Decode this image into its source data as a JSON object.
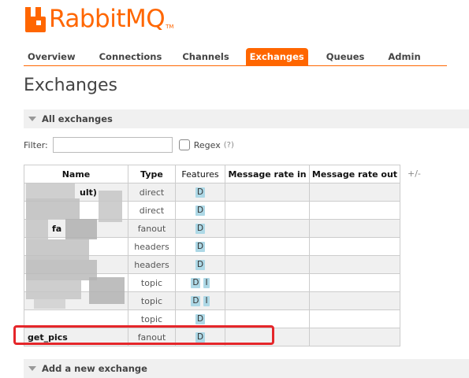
{
  "brand": {
    "name": "RabbitMQ",
    "tm": "TM",
    "color": "#ff6600"
  },
  "nav": {
    "tabs": [
      {
        "label": "Overview",
        "active": false
      },
      {
        "label": "Connections",
        "active": false
      },
      {
        "label": "Channels",
        "active": false
      },
      {
        "label": "Exchanges",
        "active": true
      },
      {
        "label": "Queues",
        "active": false
      },
      {
        "label": "Admin",
        "active": false
      }
    ]
  },
  "page": {
    "title": "Exchanges"
  },
  "all_exchanges": {
    "section_label": "All exchanges",
    "filter_label": "Filter:",
    "filter_value": "",
    "regex_label": "Regex",
    "regex_help": "(?)",
    "columns": [
      "Name",
      "Type",
      "Features",
      "Message rate in",
      "Message rate out"
    ],
    "plusminus": "+/-",
    "rows": [
      {
        "name": "ult)",
        "type": "direct",
        "features": [
          "D"
        ]
      },
      {
        "name": "",
        "type": "direct",
        "features": [
          "D"
        ]
      },
      {
        "name": "fa",
        "type": "fanout",
        "features": [
          "D"
        ]
      },
      {
        "name": "",
        "type": "headers",
        "features": [
          "D"
        ]
      },
      {
        "name": "",
        "type": "headers",
        "features": [
          "D"
        ]
      },
      {
        "name": "",
        "type": "topic",
        "features": [
          "D",
          "I"
        ]
      },
      {
        "name": "",
        "type": "topic",
        "features": [
          "D",
          "I"
        ]
      },
      {
        "name": "",
        "type": "topic",
        "features": [
          "D"
        ]
      },
      {
        "name": "get_pics",
        "type": "fanout",
        "features": [
          "D"
        ]
      }
    ]
  },
  "add_exchange": {
    "section_label": "Add a new exchange"
  },
  "annotation": {
    "color": "#e5262a"
  }
}
